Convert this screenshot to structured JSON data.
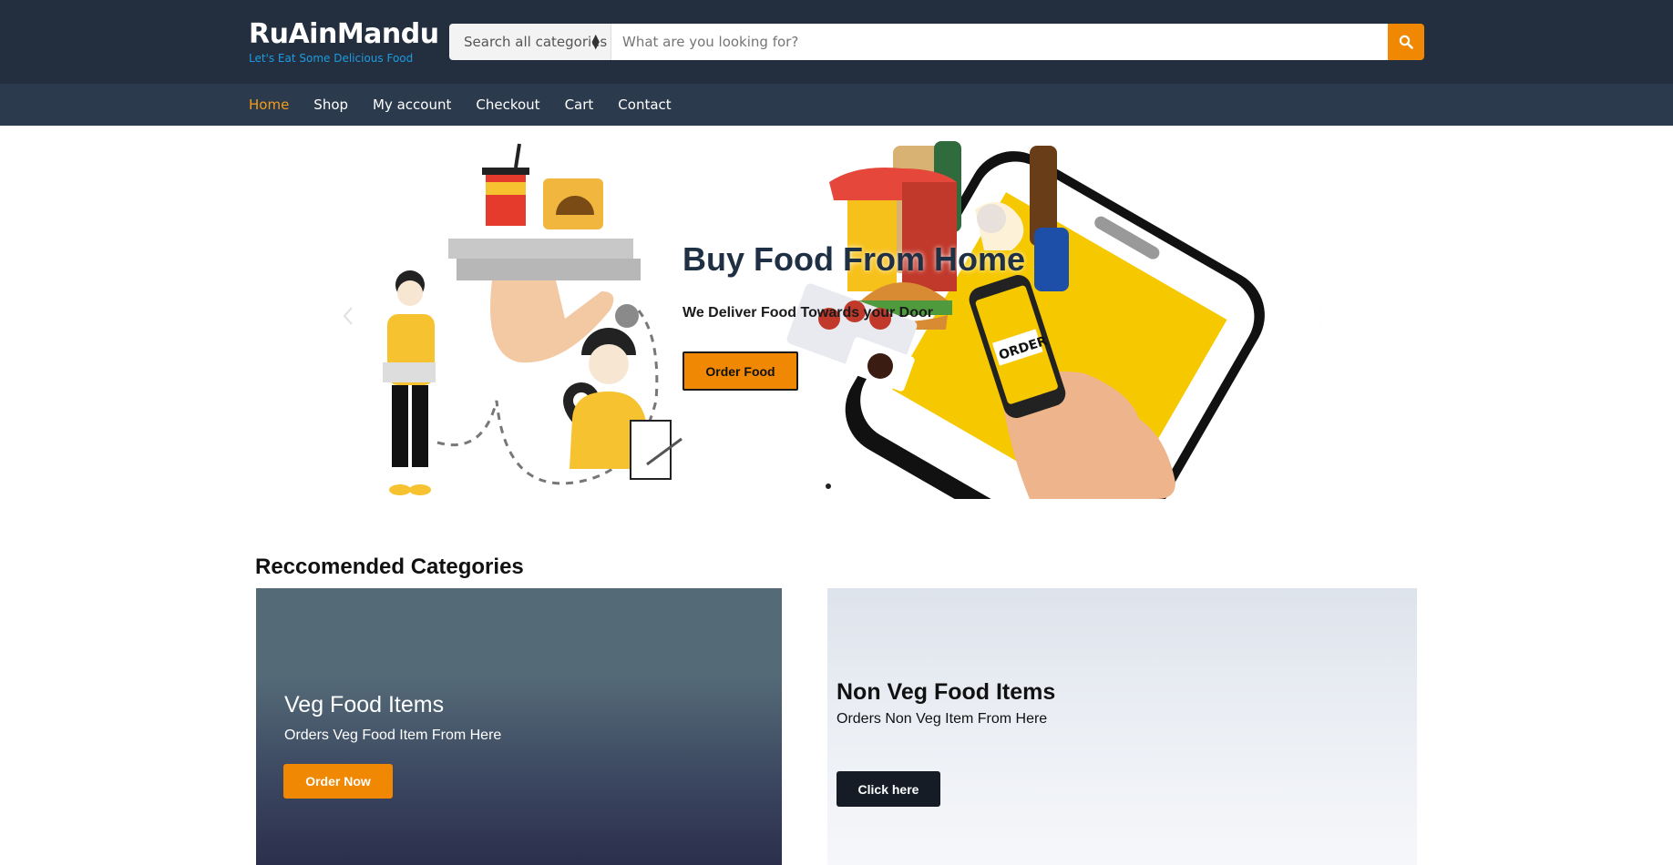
{
  "brand": {
    "title": "RuAinMandu",
    "tagline": "Let's Eat Some Delicious Food"
  },
  "search": {
    "category_label": "Search all categories",
    "placeholder": "What are you looking for?",
    "button_icon": "search-icon"
  },
  "nav": {
    "items": [
      {
        "label": "Home",
        "active": true
      },
      {
        "label": "Shop"
      },
      {
        "label": "My account"
      },
      {
        "label": "Checkout"
      },
      {
        "label": "Cart"
      },
      {
        "label": "Contact"
      }
    ]
  },
  "hero": {
    "title": "Buy Food From Home",
    "subtitle": "We Deliver Food Towards your Door",
    "button_label": "Order Food",
    "prev_icon": "chevron-left-icon",
    "next_icon": "chevron-right-icon",
    "image_name": "food-delivery-illustration"
  },
  "categories": {
    "heading": "Reccomended Categories",
    "cards": [
      {
        "title": "Veg Food Items",
        "subtitle": "Orders Veg Food Item From Here",
        "button_label": "Order Now"
      },
      {
        "title": "Non Veg Food Items",
        "subtitle": "Orders Non Veg Item From Here",
        "button_label": "Click here"
      }
    ]
  },
  "colors": {
    "header_bg": "#232f3e",
    "nav_bg": "#2b3a4c",
    "accent": "#f08804",
    "tagline": "#1e9be0",
    "active_nav": "#f59c1a"
  }
}
